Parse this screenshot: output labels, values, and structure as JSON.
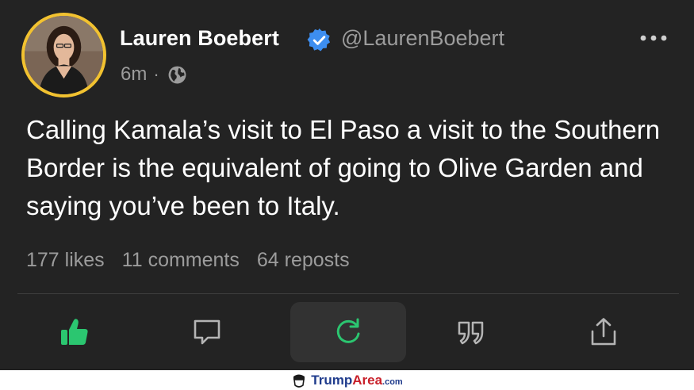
{
  "author": {
    "name": "Lauren Boebert",
    "handle": "@LaurenBoebert",
    "timestamp": "6m",
    "separator": "·",
    "visibility_icon": "globe-icon",
    "verified_icon": "verified-badge-icon",
    "avatar_ring_color": "#f2c230"
  },
  "post": {
    "text": "Calling Kamala’s visit to El Paso a visit to the Southern Border is the equivalent of going to Olive Garden and saying you’ve been to Italy."
  },
  "stats": {
    "likes": "177 likes",
    "comments": "11 comments",
    "reposts": "64 reposts"
  },
  "actions": [
    {
      "icon": "thumbs-up-icon",
      "color": "#2bc670"
    },
    {
      "icon": "comment-icon",
      "color": "#b5b5b5"
    },
    {
      "icon": "repost-icon",
      "color": "#2bc670"
    },
    {
      "icon": "quote-icon",
      "color": "#b5b5b5"
    },
    {
      "icon": "share-icon",
      "color": "#b5b5b5"
    }
  ],
  "menu_icon": "more-options-icon",
  "watermark": {
    "brand_part1": "Trump",
    "brand_part2": "Area",
    "brand_suffix": ".com"
  },
  "colors": {
    "background": "#232323",
    "primary_text": "#ffffff",
    "secondary_text": "#9c9c9c",
    "accent_green": "#2bc670",
    "verified_blue": "#3d8ef0"
  }
}
